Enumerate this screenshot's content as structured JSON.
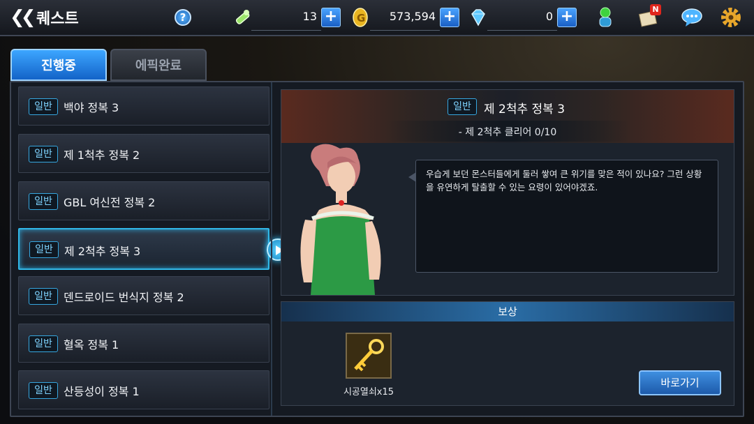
{
  "header": {
    "title": "퀘스트",
    "help_label": "?",
    "currencies": [
      {
        "icon": "stamina-icon",
        "value": "13"
      },
      {
        "icon": "gold-coin-icon",
        "value": "573,594"
      },
      {
        "icon": "gem-icon",
        "value": "0"
      }
    ],
    "plus_label": "+",
    "new_badge": "N"
  },
  "tabs": [
    {
      "label": "진행중",
      "active": true
    },
    {
      "label": "에픽완료",
      "active": false
    }
  ],
  "quest_list": [
    {
      "badge": "일반",
      "name": "백야 정복 3"
    },
    {
      "badge": "일반",
      "name": "제 1척추 정복 2"
    },
    {
      "badge": "일반",
      "name": "GBL 여신전 정복 2"
    },
    {
      "badge": "일반",
      "name": "제 2척추 정복 3",
      "selected": true
    },
    {
      "badge": "일반",
      "name": "덴드로이드 번식지 정복 2"
    },
    {
      "badge": "일반",
      "name": "혈옥 정복 1"
    },
    {
      "badge": "일반",
      "name": "산등성이 정복 1"
    }
  ],
  "detail": {
    "badge": "일반",
    "title": "제 2척추 정복 3",
    "objective": "- 제 2척추 클리어 0/10",
    "dialog": "우습게 보던 몬스터들에게 둘러 쌓여 큰 위기를 맞은 적이 있나요? 그런 상황을 유연하게 탈출할 수 있는 요령이 있어야겠죠."
  },
  "reward": {
    "header": "보상",
    "item_label": "시공열쇠x15",
    "item_icon": "golden-key-icon",
    "go_button": "바로가기"
  },
  "colors": {
    "accent": "#31b8e8",
    "tab_active": "#1f7fe0",
    "badge": "#36a7e0"
  }
}
